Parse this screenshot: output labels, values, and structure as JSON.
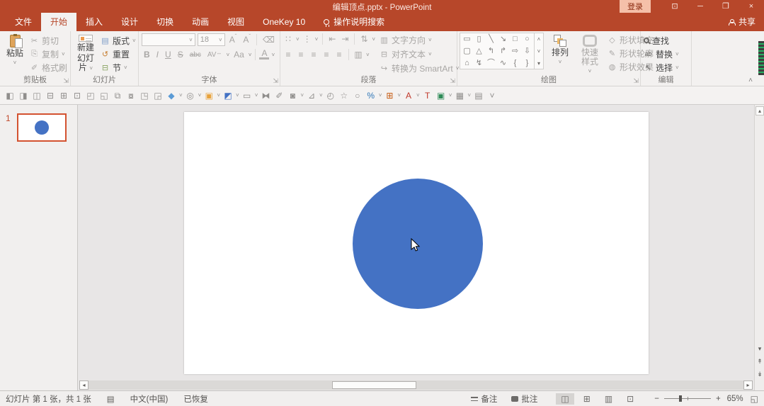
{
  "titlebar": {
    "title": "编辑顶点.pptx - PowerPoint",
    "sign_in": "登录"
  },
  "tabs": {
    "items": [
      {
        "label": "文件"
      },
      {
        "label": "开始"
      },
      {
        "label": "插入"
      },
      {
        "label": "设计"
      },
      {
        "label": "切换"
      },
      {
        "label": "动画"
      },
      {
        "label": "视图"
      },
      {
        "label": "OneKey 10"
      }
    ],
    "search_label": "操作说明搜索",
    "share": "共享"
  },
  "ribbon": {
    "clipboard": {
      "label": "剪贴板",
      "paste": "粘贴",
      "cut": "剪切",
      "copy": "复制",
      "format_painter": "格式刷"
    },
    "slides": {
      "label": "幻灯片",
      "new_slide_line1": "新建",
      "new_slide_line2": "幻灯片",
      "layout": "版式",
      "reset": "重置",
      "section": "节"
    },
    "font": {
      "label": "字体",
      "name_value": "",
      "size": "18",
      "letter_a": "A",
      "bold": "B",
      "italic": "I",
      "underline": "U",
      "strike": "S",
      "abc": "abc",
      "spacing": "AV",
      "case_btn": "Aa",
      "color": "A"
    },
    "paragraph": {
      "label": "段落",
      "text_direction": "文字方向",
      "align_text": "对齐文本",
      "smartart": "转换为 SmartArt"
    },
    "drawing": {
      "label": "绘图",
      "arrange": "排列",
      "quick_styles": "快速样式",
      "shape_fill": "形状填充",
      "shape_outline": "形状轮廓",
      "shape_effects": "形状效果",
      "shapes": [
        {
          "n": "text-box-icon",
          "g": "▭"
        },
        {
          "n": "vertical-text-box-icon",
          "g": "▯"
        },
        {
          "n": "line-icon",
          "g": "╲"
        },
        {
          "n": "arrow-icon",
          "g": "↘"
        },
        {
          "n": "rectangle-icon",
          "g": "□"
        },
        {
          "n": "oval-icon",
          "g": "○"
        },
        {
          "n": "rounded-rectangle-icon",
          "g": "▢"
        },
        {
          "n": "triangle-icon",
          "g": "△"
        },
        {
          "n": "elbow-connector-icon",
          "g": "↰"
        },
        {
          "n": "elbow-arrow-connector-icon",
          "g": "↱"
        },
        {
          "n": "right-arrow-icon",
          "g": "⇨"
        },
        {
          "n": "down-arrow-icon",
          "g": "⇩"
        },
        {
          "n": "freeform-icon",
          "g": "⌂"
        },
        {
          "n": "scribble-icon",
          "g": "↯"
        },
        {
          "n": "arc-icon",
          "g": "⌒"
        },
        {
          "n": "curve-icon",
          "g": "∿"
        },
        {
          "n": "left-brace-icon",
          "g": "{"
        },
        {
          "n": "right-brace-icon",
          "g": "}"
        }
      ]
    },
    "editing": {
      "label": "编辑",
      "find": "查找",
      "replace": "替换",
      "select": "选择",
      "replace_glyph": "ab",
      "select_glyph": "↖"
    }
  },
  "quickbar": {
    "icons": [
      {
        "n": "align-objects-left-icon",
        "g": "◧"
      },
      {
        "n": "align-objects-right-icon",
        "g": "◨"
      },
      {
        "n": "distribute-horizontal-icon",
        "g": "◫"
      },
      {
        "n": "distribute-vertical-icon",
        "g": "⊟"
      },
      {
        "n": "align-center-horizontal-icon",
        "g": "⊞"
      },
      {
        "n": "align-middle-vertical-icon",
        "g": "⊡"
      },
      {
        "n": "equal-width-icon",
        "g": "◰"
      },
      {
        "n": "equal-height-icon",
        "g": "◱"
      },
      {
        "n": "group-shapes-icon",
        "g": "⧉"
      },
      {
        "n": "ungroup-shapes-icon",
        "g": "⧇"
      },
      {
        "n": "regroup-shapes-icon",
        "g": "◳"
      },
      {
        "n": "align-to-slide-icon",
        "g": "◲"
      },
      {
        "n": "merge-shapes-icon",
        "g": "◆",
        "c": "#5B9BD5",
        "dd": true
      },
      {
        "n": "intersect-shapes-icon",
        "g": "◎",
        "dd": true
      },
      {
        "n": "fill-color-icon",
        "g": "▣",
        "c": "#E8A33D",
        "dd": true
      },
      {
        "n": "theme-colors-icon",
        "g": "◩",
        "c": "#4472C4",
        "dd": true
      },
      {
        "n": "insert-textbox-icon",
        "g": "▭",
        "dd": true
      },
      {
        "n": "swap-shapes-icon",
        "g": "⧓"
      },
      {
        "n": "format-painter-mini-icon",
        "g": "✐"
      },
      {
        "n": "fill-bucket-icon",
        "g": "◙",
        "dd": true
      },
      {
        "n": "shape-rotate-icon",
        "g": "⊿",
        "dd": true
      },
      {
        "n": "animation-timing-icon",
        "g": "◴"
      },
      {
        "n": "animation-star-icon",
        "g": "☆"
      },
      {
        "n": "oval-tool-icon",
        "g": "○"
      },
      {
        "n": "percent-scale-icon",
        "g": "%",
        "c": "#2E75B6",
        "dd": true
      },
      {
        "n": "table-tool-icon",
        "g": "⊞",
        "c": "#C55A11",
        "dd": true
      },
      {
        "n": "remove-text-icon",
        "g": "A",
        "c": "#C0392B",
        "dd": true
      },
      {
        "n": "text-tool-icon",
        "g": "T",
        "c": "#C0392B"
      },
      {
        "n": "lock-aspect-icon",
        "g": "▣",
        "c": "#2E8B57",
        "dd": true
      },
      {
        "n": "export-picture-icon",
        "g": "▦",
        "dd": true
      },
      {
        "n": "insert-picture-icon",
        "g": "▤"
      },
      {
        "n": "more-tools-icon",
        "g": "˅"
      }
    ]
  },
  "slide_panel": {
    "slide_number": "1"
  },
  "statusbar": {
    "slide_info": "幻灯片 第 1 张，共 1 张",
    "language": "中文(中国)",
    "recovered": "已恢复",
    "notes": "备注",
    "comments": "批注",
    "zoom": "65%"
  },
  "icons": {
    "dropdown": "˅",
    "dropup": "˄",
    "caret_up": "ˆ",
    "caret_down": "ˇ",
    "minimize": "─",
    "restore": "❐",
    "close": "×",
    "ribbon_display": "⊡",
    "scissors": "✂",
    "copy": "⎘",
    "brush": "✐",
    "eraser": "⌫",
    "layout": "▤",
    "reset": "↺",
    "section": "⊟",
    "bullets": "∷",
    "numbering": "⋮",
    "dedent": "⇤",
    "indent": "⇥",
    "line_spacing": "⇅",
    "text_direction": "▥",
    "align_text": "⊟",
    "smartart": "↪",
    "align": "≡",
    "columns": "▥",
    "spacing_arrow": "↔",
    "fill": "◇",
    "outline": "✎",
    "effects": "◍",
    "book": "▤",
    "normal_view": "◫",
    "sorter_view": "⊞",
    "reading_view": "▥",
    "slideshow_view": "⊡",
    "minus": "−",
    "plus": "+",
    "fit": "◱",
    "up": "▴",
    "down": "▾",
    "left": "◂",
    "right": "▸",
    "prev": "↟",
    "next": "↡",
    "collapse": "˄",
    "launcher": "⇲",
    "gallery_up": "˄",
    "gallery_down": "˅",
    "gallery_more": "▾"
  },
  "colors": {
    "accent": "#B7472A",
    "circle_fill": "#4472C4",
    "selection_border": "#D35230"
  }
}
